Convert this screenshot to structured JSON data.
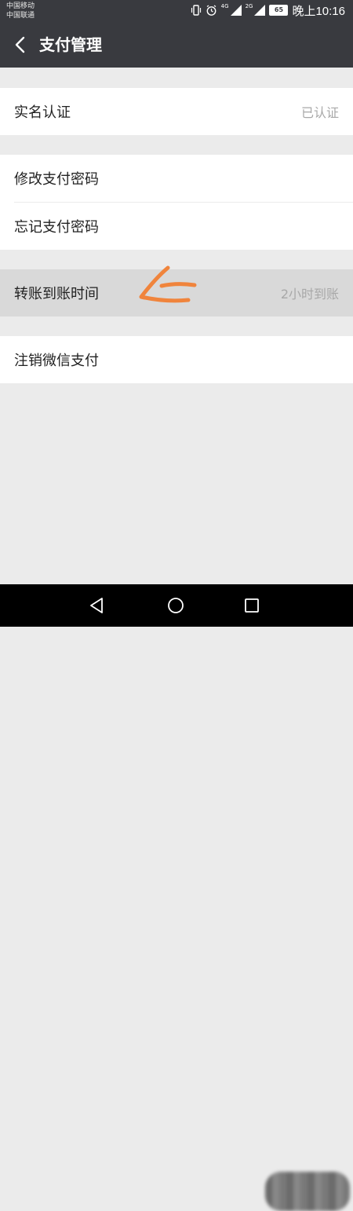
{
  "status_bar": {
    "carrier_1": "中国移动",
    "carrier_2": "中国联通",
    "net_1": "4G",
    "net_2": "2G",
    "battery": "65",
    "time": "晚上10:16",
    "icons": [
      "vibrate-icon",
      "alarm-icon",
      "signal-4g-icon",
      "signal-2g-icon",
      "battery-icon"
    ]
  },
  "header": {
    "title": "支付管理",
    "back_icon": "chevron-left-icon"
  },
  "sections": [
    {
      "rows": [
        {
          "label": "实名认证",
          "value": "已认证"
        }
      ]
    },
    {
      "rows": [
        {
          "label": "修改支付密码"
        },
        {
          "label": "忘记支付密码"
        }
      ]
    },
    {
      "rows": [
        {
          "label": "转账到账时间",
          "value": "2小时到账",
          "highlighted": true
        }
      ]
    },
    {
      "rows": [
        {
          "label": "注销微信支付"
        }
      ]
    }
  ],
  "annotation": {
    "icon": "hand-drawn-arrow-icon",
    "color": "#f0843c"
  },
  "nav_bar": {
    "icons": [
      "triangle-back-icon",
      "circle-home-icon",
      "square-recent-icon"
    ]
  }
}
